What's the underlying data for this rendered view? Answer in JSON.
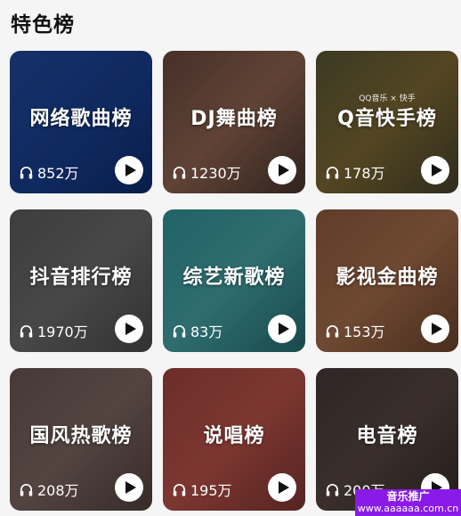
{
  "section": {
    "title": "特色榜"
  },
  "colors": {
    "play_icon": "#111111",
    "watermark_bg": "#8a1ae8"
  },
  "icons": {
    "listen": "headphones-icon",
    "play": "play-icon"
  },
  "charts": [
    {
      "name": "网络歌曲榜",
      "count": "852万",
      "bg": "linear-gradient(135deg,#1d3f86 0%,#14367a 55%,#0c2560 100%)"
    },
    {
      "name": "DJ舞曲榜",
      "count": "1230万",
      "bg": "linear-gradient(135deg,#5a3e36 0%,#7b5645 50%,#3f2d27 100%)"
    },
    {
      "name": "Q音快手榜",
      "count": "178万",
      "bg": "linear-gradient(135deg,#4c4a2e 0%,#6b5a2c 50%,#3e3a25 100%)",
      "brand": "QQ音乐 × 快手"
    },
    {
      "name": "抖音排行榜",
      "count": "1970万",
      "bg": "linear-gradient(135deg,#4f4f4f 0%,#5c5c5c 50%,#404040 100%)"
    },
    {
      "name": "综艺新歌榜",
      "count": "83万",
      "bg": "linear-gradient(135deg,#2b7f84 0%,#3c8c8f 50%,#205e62 100%)"
    },
    {
      "name": "影视金曲榜",
      "count": "153万",
      "bg": "linear-gradient(135deg,#7a4f36 0%,#8e5e40 50%,#5e3b28 100%)"
    },
    {
      "name": "国风热歌榜",
      "count": "208万",
      "bg": "linear-gradient(135deg,#5a4a47 0%,#6b5853 50%,#463836 100%)"
    },
    {
      "name": "说唱榜",
      "count": "195万",
      "bg": "linear-gradient(135deg,#8a3b36 0%,#a0473f 50%,#6e2e2b 100%)"
    },
    {
      "name": "电音榜",
      "count": "200万",
      "bg": "linear-gradient(135deg,#3c3230 0%,#4a3c38 50%,#2e2624 100%)"
    }
  ],
  "watermark": {
    "line1": "音乐推广",
    "line2": "www.aaaaaa.com.cn"
  }
}
